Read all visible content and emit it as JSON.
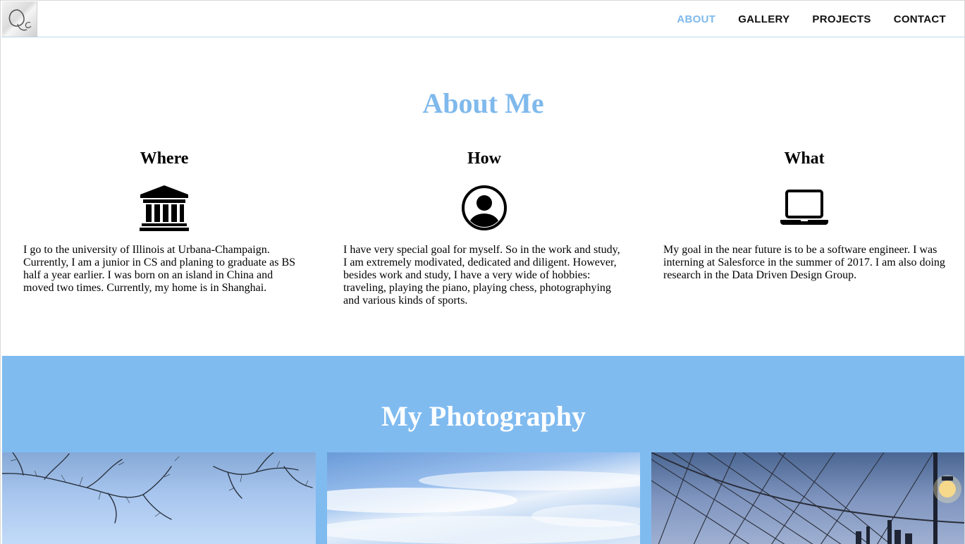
{
  "nav": {
    "logo_alt": "Qc",
    "items": [
      {
        "label": "ABOUT",
        "active": true
      },
      {
        "label": "GALLERY",
        "active": false
      },
      {
        "label": "PROJECTS",
        "active": false
      },
      {
        "label": "CONTACT",
        "active": false
      }
    ]
  },
  "about": {
    "title": "About Me",
    "columns": [
      {
        "heading": "Where",
        "icon": "university-icon",
        "text": "I go to the university of Illinois at Urbana-Champaign. Currently, I am a junior in CS and planing to graduate as BS half a year earlier. I was born on an island in China and moved two times. Currently, my home is in Shanghai."
      },
      {
        "heading": "How",
        "icon": "user-circle-icon",
        "text": "I have very special goal for myself. So in the work and study, I am extremely modivated, dedicated and diligent. However, besides work and study, I have a very wide of hobbies: traveling, playing the piano, playing chess, photographying and various kinds of sports."
      },
      {
        "heading": "What",
        "icon": "laptop-icon",
        "text": "My goal in the near future is to be a software engineer. I was interning at Salesforce in the summer of 2017. I am also doing research in the Data Driven Design Group."
      }
    ]
  },
  "photography": {
    "title": "My Photography",
    "photos": [
      "tree-branches-sky-photo",
      "clouds-sky-photo",
      "bridge-cables-photo"
    ]
  },
  "colors": {
    "accent": "#7fb9ec",
    "photo_section_bg": "#80bbf0",
    "text": "#000000"
  }
}
